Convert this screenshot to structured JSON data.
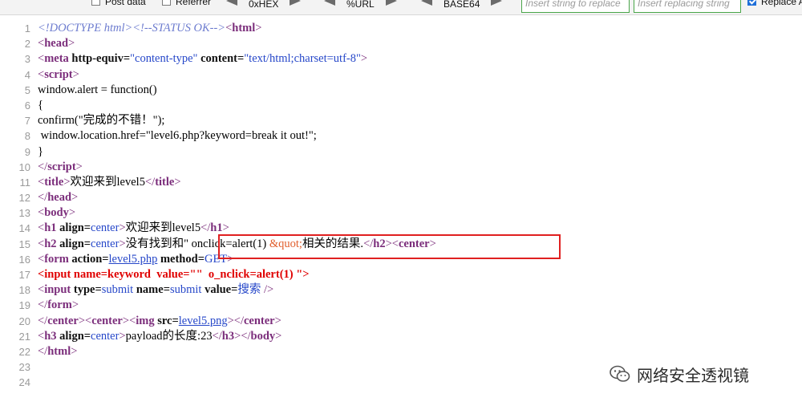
{
  "toolbar": {
    "post_data_label": "Post data",
    "post_data_checked": false,
    "referrer_label": "Referrer",
    "referrer_checked": false,
    "hex_label": "0xHEX",
    "url_label": "%URL",
    "base64_label": "BASE64",
    "search_placeholder": "Insert string to replace",
    "replace_placeholder": "Insert replacing string",
    "replace_all_label": "Replace A",
    "replace_all_checked": true
  },
  "source": {
    "line_numbers": [
      "1",
      "2",
      "3",
      "4",
      "5",
      "6",
      "7",
      "8",
      "9",
      "10",
      "11",
      "12",
      "13",
      "14",
      "15",
      "16",
      "17",
      "18",
      "19",
      "20",
      "21",
      "22",
      "23",
      "24"
    ],
    "l1": {
      "doctype": "<!DOCTYPE html>",
      "comment": "<!--STATUS OK-->",
      "open": "<",
      "name": "html",
      "close": ">"
    },
    "l2": {
      "open": "<",
      "name": "head",
      "close": ">"
    },
    "l3": {
      "open": "<",
      "name": "meta",
      "a1": "http-equiv",
      "eq1": "=",
      "v1": "\"content-type\"",
      "a2": "content",
      "eq2": "=",
      "v2": "\"text/html;charset=utf-8\"",
      "close": ">"
    },
    "l4": {
      "open": "<",
      "name": "script",
      "close": ">"
    },
    "l5": "window.alert = function()",
    "l6": "{",
    "l7": "confirm(\"完成的不错！\");",
    "l8": " window.location.href=\"level6.php?keyword=break it out!\";",
    "l9": "}",
    "l10": {
      "open": "</",
      "name": "script",
      "close": ">"
    },
    "l11": {
      "open": "<",
      "name": "title",
      "close": ">",
      "text": "欢迎来到level5",
      "open2": "</",
      "name2": "title",
      "close2": ">"
    },
    "l12": {
      "open": "</",
      "name": "head",
      "close": ">"
    },
    "l13": {
      "open": "<",
      "name": "body",
      "close": ">"
    },
    "l14": {
      "open": "<",
      "name": "h1",
      "a1": "align",
      "eq1": "=",
      "v1": "center",
      "close": ">",
      "text": "欢迎来到level5",
      "open2": "</",
      "name2": "h1",
      "close2": ">"
    },
    "l15": {
      "open": "<",
      "name": "h2",
      "a1": "align",
      "eq1": "=",
      "v1": "center",
      "close": ">",
      "text": "没有找到和\" onclick=alert(1) ",
      "entity": "&quot;",
      "text2": "相关的结果.",
      "open2": "</",
      "name2": "h2",
      "close2": ">",
      "open3": "<",
      "name3": "center",
      "close3": ">"
    },
    "l16": {
      "open": "<",
      "name": "form",
      "a1": "action",
      "eq1": "=",
      "v1": "level5.php",
      "a2": "method",
      "eq2": "=",
      "v2": "GET",
      "close": ">"
    },
    "l17": "<input name=keyword  value=\"\"  o_nclick=alert(1) \">",
    "l18": {
      "open": "<",
      "name": "input",
      "a1": "type",
      "eq1": "=",
      "v1": "submit",
      "a2": "name",
      "eq2": "=",
      "v2": "submit",
      "a3": "value",
      "eq3": "=",
      "v3": "搜索",
      "close": " />"
    },
    "l19": {
      "open": "</",
      "name": "form",
      "close": ">"
    },
    "l20": {
      "open": "</",
      "name": "center",
      "close": ">",
      "open2": "<",
      "name2": "center",
      "close2": ">",
      "open3": "<",
      "name3": "img",
      "a1": "src",
      "eq1": "=",
      "v1": "level5.png",
      "close3": ">",
      "open4": "</",
      "name4": "center",
      "close4": ">"
    },
    "l21": {
      "open": "<",
      "name": "h3",
      "a1": "align",
      "eq1": "=",
      "v1": "center",
      "close": ">",
      "text": "payload的长度:23",
      "open2": "</",
      "name2": "h3",
      "close2": ">",
      "open3": "</",
      "name3": "body",
      "close3": ">"
    },
    "l22": {
      "open": "</",
      "name": "html",
      "close": ">"
    }
  },
  "watermark": {
    "text": "网络安全透视镜",
    "icon": "wechat-icon"
  }
}
